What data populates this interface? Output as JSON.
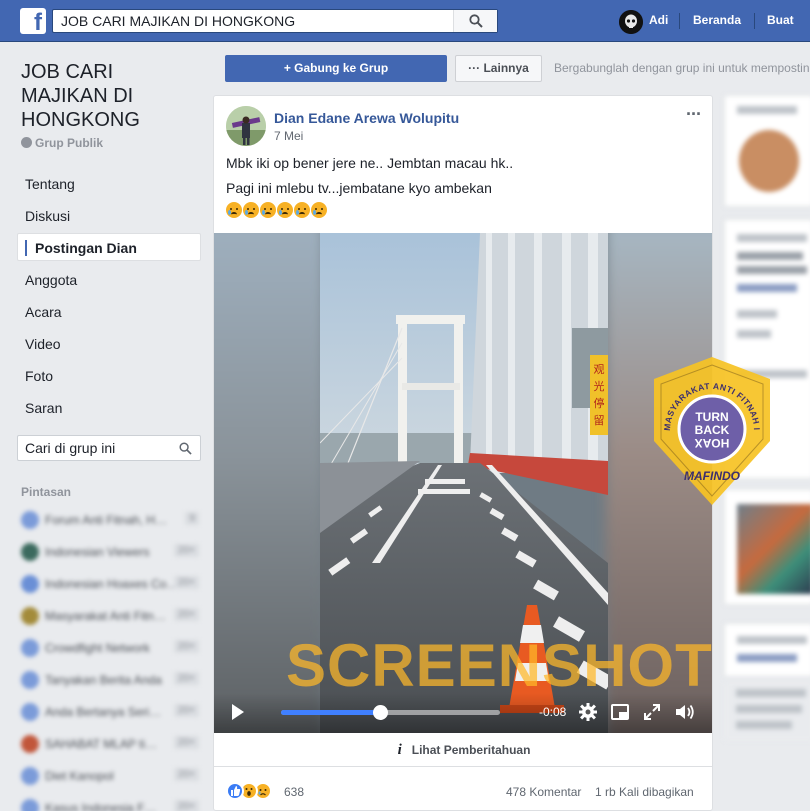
{
  "topbar": {
    "search_value": "JOB CARI MAJIKAN DI HONGKONG",
    "user_name": "Adi",
    "home_label": "Beranda",
    "create_label": "Buat"
  },
  "group": {
    "title": "JOB CARI MAJIKAN DI HONGKONG",
    "privacy": "Grup Publik"
  },
  "nav": {
    "items": [
      "Tentang",
      "Diskusi",
      "Postingan Dian",
      "Anggota",
      "Acara",
      "Video",
      "Foto",
      "Saran"
    ],
    "active": "Postingan Dian",
    "search_placeholder": "Cari di grup ini"
  },
  "shortcuts": {
    "title": "Pintasan"
  },
  "actions": {
    "join_label": "+ Gabung ke Grup",
    "more_label": "··· Lainnya",
    "join_hint": "Bergabunglah dengan grup ini untuk memposting"
  },
  "post": {
    "author": "Dian Edane Arewa Wolupitu",
    "date": "7 Mei",
    "line1": "Mbk iki op bener jere ne.. Jembtan macau hk..",
    "line2": "Pagi ini mlebu tv...jembatane kyo ambekan",
    "emoji": [
      "crying-face",
      "crying-face",
      "crying-face",
      "crying-face",
      "crying-face",
      "crying-face"
    ],
    "video": {
      "watermark": "SCREENSHOT BY",
      "sign_text": "观光停留",
      "time_remaining": "-0:08",
      "progress": 0.45
    },
    "notice_label": "Lihat Pemberitahuan",
    "reaction_count": "638",
    "comments_label": "478 Komentar",
    "shares_label": "1 rb Kali dibagikan"
  },
  "badge": {
    "ring_text": "MASYARAKAT ANTI FITNAH INDONESIA",
    "line1": "TURN",
    "line2": "BACK",
    "line3": "HOAX",
    "bottom": "MAFINDO"
  },
  "colors": {
    "facebook_blue": "#4267b2",
    "link_blue": "#365899",
    "watermark_orange": "#ffb928",
    "badge_yellow": "#f6c325",
    "badge_purple": "#6e5fa8"
  }
}
